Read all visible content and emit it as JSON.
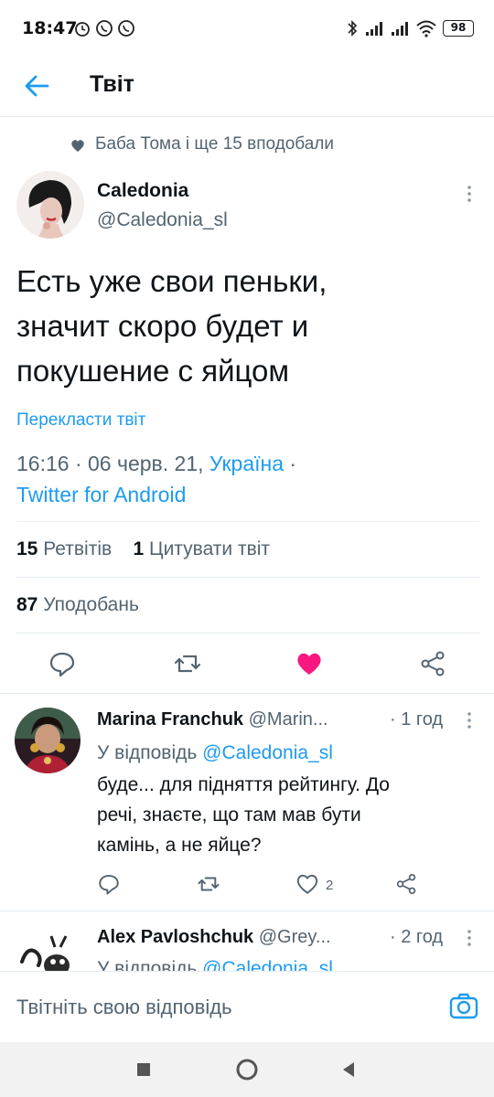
{
  "status_bar": {
    "time": "18:47",
    "battery": "98"
  },
  "header": {
    "title": "Твіт"
  },
  "social_context": "Баба Тома і ще 15 вподобали",
  "tweet": {
    "author_name": "Caledonia",
    "author_handle": "@Caledonia_sl",
    "text_lines": [
      "Есть уже свои пеньки,",
      "значит скоро будет и",
      "покушение с яйцом"
    ],
    "translate_label": "Перекласти твіт",
    "time": "16:16",
    "date": "06 черв. 21",
    "location": "Україна",
    "source": "Twitter for Android",
    "retweets_count": "15",
    "retweets_label": "Ретвітів",
    "quotes_count": "1",
    "quotes_label": "Цитувати твіт",
    "likes_count": "87",
    "likes_label": "Уподобань",
    "liked": true
  },
  "replies": [
    {
      "name": "Marina Franchuk",
      "handle": "@Marin...",
      "time": "· 1 год",
      "replying_prefix": "У відповідь",
      "replying_to": "@Caledonia_sl",
      "text_lines": [
        "буде... для підняття рейтингу. До",
        "речі, знаєте, що там мав бути",
        "камінь, а не яйце?"
      ],
      "like_count": "2"
    },
    {
      "name": "Alex Pavloshchuk",
      "handle": "@Grey...",
      "time": "· 2 год",
      "replying_prefix": "У відповідь",
      "replying_to": "@Caledonia_sl"
    }
  ],
  "compose": {
    "placeholder": "Твітніть свою відповідь"
  },
  "colors": {
    "accent": "#1d9bf0",
    "like": "#f91880",
    "secondary_text": "#536471"
  }
}
